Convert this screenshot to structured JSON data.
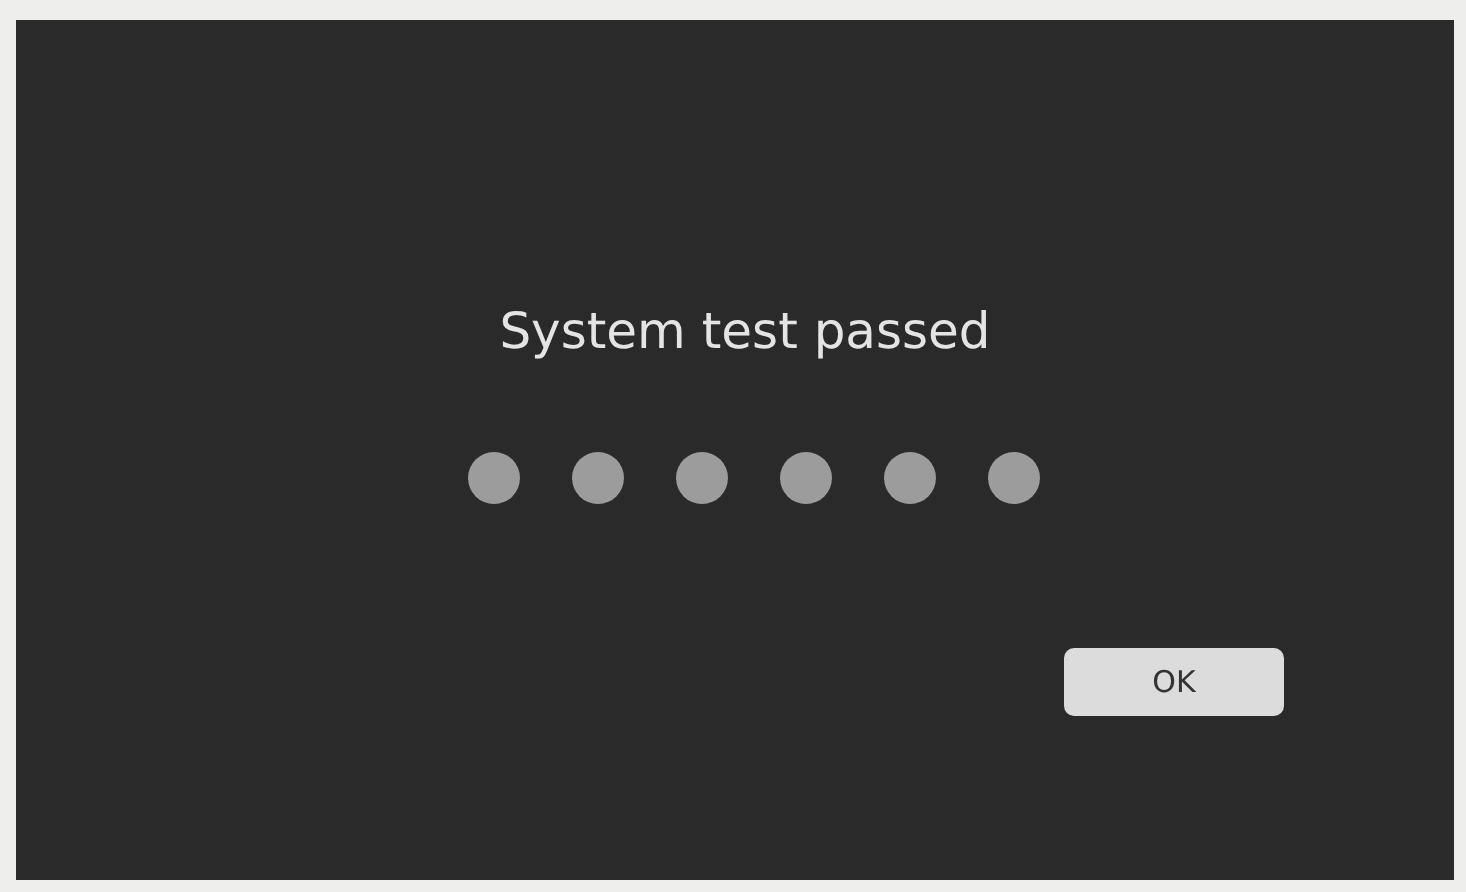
{
  "dialog": {
    "message": "System test passed",
    "button": "OK"
  }
}
